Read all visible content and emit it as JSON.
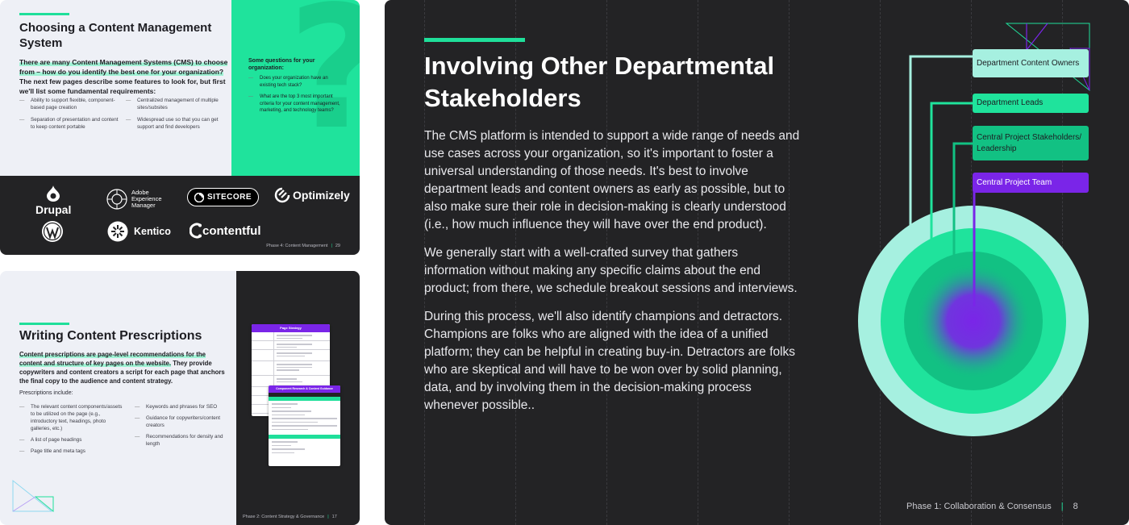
{
  "panel1": {
    "title": "Choosing a Content Management System",
    "intro_highlight": "There are many Content Management Systems (CMS) to choose from – how do you identify the best one for your organization?",
    "intro_rest": " The next few pages describe some features to look for, but first we'll list some fundamental requirements:",
    "requirements": [
      "Ability to support flexible, component-based page creation",
      "Centralized management of multiple sites/subsites",
      "Separation of presentation and content to keep content portable",
      "Widespread use so that you can get support and find developers"
    ],
    "questions_title": "Some questions for your organization:",
    "questions": [
      "Does your organization have an existing tech stack?",
      "What are the top 3 most important criteria for your content management, marketing, and technology teams?"
    ],
    "logos": {
      "drupal": "Drupal",
      "adobe": [
        "Adobe",
        "Experience",
        "Manager"
      ],
      "sitecore": "SITECORE",
      "optimizely": "Optimizely",
      "kentico": "Kentico",
      "contentful": "contentful"
    },
    "footer_label": "Phase 4: Content Management",
    "footer_page": "29"
  },
  "panel2": {
    "title": "Writing Content Prescriptions",
    "intro_highlight": "Content prescriptions are page-level recommendations for the content and structure of key pages on the website.",
    "intro_rest": " They provide copywriters and content creators a script for each page that anchors the final copy to the audience and content strategy.",
    "prescriptions_label": "Prescriptions include:",
    "col1": [
      "The relevant content components/assets to be utilized on the page (e.g., introductory text, headings, photo galleries, etc.)",
      "A list of page headings",
      "Page title and meta tags"
    ],
    "col2": [
      "Keywords and phrases for SEO",
      "Guidance for copywriters/content creators",
      "Recommendations for density and length"
    ],
    "doc1_title": "Page Strategy",
    "doc2_title": "Component Research & Content Guidance",
    "footer_label": "Phase 2: Content Strategy & Governance",
    "footer_page": "17"
  },
  "panel3": {
    "title": "Involving Other Departmental Stakeholders",
    "paragraphs": [
      "The CMS platform is intended to support a wide range of needs and use cases across your organization, so it's important to foster a universal understanding of those needs. It's best to involve department leads and content owners as early as possible, but to also make sure their role in decision-making is clearly understood (i.e., how much influence they will have over the end product).",
      "We generally start with a well-crafted survey that gathers information without making any specific claims about the end product; from there, we schedule breakout sessions and interviews.",
      "During this process, we'll also identify champions and detractors. Champions are folks who are aligned with the idea of a unified platform; they can be helpful in creating buy-in. Detractors are folks who are skeptical and will have to be won over by solid planning, data, and by involving them in the decision-making process whenever possible.."
    ],
    "diagram_labels": [
      "Department Content Owners",
      "Department Leads",
      "Central Project Stakeholders/ Leadership",
      "Central Project Team"
    ],
    "colors": {
      "ring1": "#a6f0e0",
      "ring2": "#1fe39c",
      "ring3": "#12c183",
      "core": "#7a25e8"
    },
    "footer_label": "Phase 1: Collaboration & Consensus",
    "footer_page": "8"
  }
}
